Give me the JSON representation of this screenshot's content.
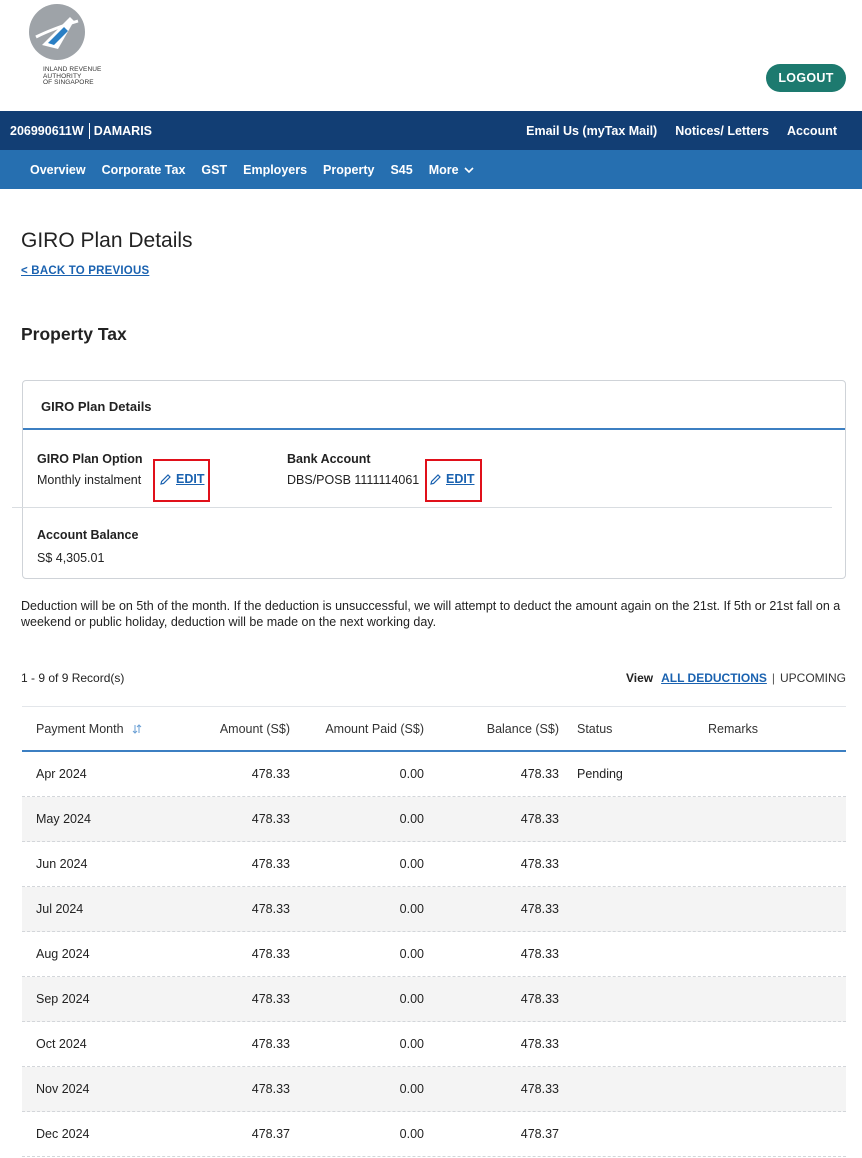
{
  "header": {
    "logo_text_line1": "INLAND REVENUE",
    "logo_text_line2": "AUTHORITY",
    "logo_text_line3": "OF SINGAPORE",
    "logout_label": "LOGOUT",
    "brand_color": "#1d7a6f"
  },
  "topbar": {
    "account_id": "206990611W",
    "account_name": "DAMARIS",
    "links": [
      "Email Us (myTax Mail)",
      "Notices/ Letters",
      "Account"
    ],
    "bg": "#123e74"
  },
  "subnav": {
    "items": [
      "Overview",
      "Corporate Tax",
      "GST",
      "Employers",
      "Property",
      "S45",
      "More"
    ],
    "bg": "#266fb0"
  },
  "page": {
    "title": "GIRO Plan Details",
    "back_label": "< BACK TO PREVIOUS",
    "section_title": "Property Tax"
  },
  "card": {
    "title": "GIRO Plan Details",
    "plan_option_label": "GIRO Plan Option",
    "plan_option_value": "Monthly instalment",
    "bank_label": "Bank Account",
    "bank_value": "DBS/POSB 1111114061",
    "edit_label": "EDIT",
    "balance_label": "Account Balance",
    "balance_value": "S$ 4,305.01"
  },
  "notice": "Deduction will be on 5th of the month. If the deduction is unsuccessful, we will attempt to deduct the amount again on the 21st. If 5th or 21st fall on a weekend or public holiday, deduction will be made on the next working day.",
  "records": {
    "count_label": "1 - 9 of 9 Record(s)",
    "view_label": "View",
    "all_label": "ALL DEDUCTIONS",
    "upcoming_label": "UPCOMING"
  },
  "table": {
    "headers": [
      "Payment Month",
      "Amount (S$)",
      "Amount Paid (S$)",
      "Balance (S$)",
      "Status",
      "Remarks"
    ],
    "rows": [
      [
        "Apr 2024",
        "478.33",
        "0.00",
        "478.33",
        "Pending",
        ""
      ],
      [
        "May 2024",
        "478.33",
        "0.00",
        "478.33",
        "",
        ""
      ],
      [
        "Jun 2024",
        "478.33",
        "0.00",
        "478.33",
        "",
        ""
      ],
      [
        "Jul 2024",
        "478.33",
        "0.00",
        "478.33",
        "",
        ""
      ],
      [
        "Aug 2024",
        "478.33",
        "0.00",
        "478.33",
        "",
        ""
      ],
      [
        "Sep 2024",
        "478.33",
        "0.00",
        "478.33",
        "",
        ""
      ],
      [
        "Oct 2024",
        "478.33",
        "0.00",
        "478.33",
        "",
        ""
      ],
      [
        "Nov 2024",
        "478.33",
        "0.00",
        "478.33",
        "",
        ""
      ],
      [
        "Dec 2024",
        "478.37",
        "0.00",
        "478.37",
        "",
        ""
      ]
    ]
  }
}
